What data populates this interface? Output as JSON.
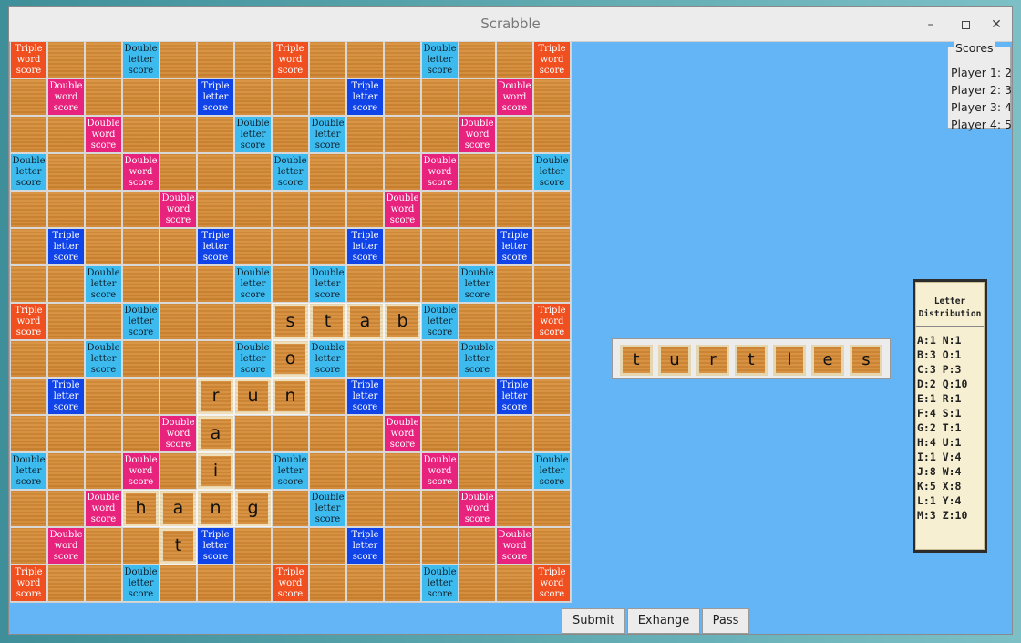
{
  "window": {
    "title": "Scrabble"
  },
  "board": {
    "rows": [
      [
        "TW",
        "",
        "",
        "DL",
        "",
        "",
        "",
        "TW",
        "",
        "",
        "",
        "DL",
        "",
        "",
        "TW"
      ],
      [
        "",
        "DW",
        "",
        "",
        "",
        "TL",
        "",
        "",
        "",
        "TL",
        "",
        "",
        "",
        "DW",
        ""
      ],
      [
        "",
        "",
        "DW",
        "",
        "",
        "",
        "DL",
        "",
        "DL",
        "",
        "",
        "",
        "DW",
        "",
        ""
      ],
      [
        "DL",
        "",
        "",
        "DW",
        "",
        "",
        "",
        "DL",
        "",
        "",
        "",
        "DW",
        "",
        "",
        "DL"
      ],
      [
        "",
        "",
        "",
        "",
        "DW",
        "",
        "",
        "",
        "",
        "",
        "DW",
        "",
        "",
        "",
        ""
      ],
      [
        "",
        "TL",
        "",
        "",
        "",
        "TL",
        "",
        "",
        "",
        "TL",
        "",
        "",
        "",
        "TL",
        ""
      ],
      [
        "",
        "",
        "DL",
        "",
        "",
        "",
        "DL",
        "",
        "DL",
        "",
        "",
        "",
        "DL",
        "",
        ""
      ],
      [
        "TW",
        "",
        "",
        "DL",
        "",
        "",
        "",
        "=s",
        "=t",
        "=a",
        "=b",
        "DL",
        "",
        "",
        "TW"
      ],
      [
        "",
        "",
        "DL",
        "",
        "",
        "",
        "DL",
        "=o",
        "DL",
        "",
        "",
        "",
        "DL",
        "",
        ""
      ],
      [
        "",
        "TL",
        "",
        "",
        "",
        "=r",
        "=u",
        "=n",
        "",
        "TL",
        "",
        "",
        "",
        "TL",
        ""
      ],
      [
        "",
        "",
        "",
        "",
        "DW",
        "=a",
        "",
        "",
        "",
        "",
        "DW",
        "",
        "",
        "",
        ""
      ],
      [
        "DL",
        "",
        "",
        "DW",
        "",
        "=i",
        "",
        "DL",
        "",
        "",
        "",
        "DW",
        "",
        "",
        "DL"
      ],
      [
        "",
        "",
        "DW",
        "=h",
        "=a",
        "=n",
        "=g",
        "",
        "DL",
        "",
        "",
        "",
        "DW",
        "",
        ""
      ],
      [
        "",
        "DW",
        "",
        "",
        "=t",
        "TL",
        "",
        "",
        "",
        "TL",
        "",
        "",
        "",
        "DW",
        ""
      ],
      [
        "TW",
        "",
        "",
        "DL",
        "",
        "",
        "",
        "TW",
        "",
        "",
        "",
        "DL",
        "",
        "",
        "TW"
      ]
    ],
    "labels": {
      "TW": "Triple word score",
      "DW": "Double word score",
      "TL": "Triple letter score",
      "DL": "Double letter score"
    }
  },
  "scores": {
    "title": "Scores",
    "players": [
      "Player 1: 2",
      "Player 2: 3",
      "Player 3: 4",
      "Player 4: 5"
    ]
  },
  "rack": {
    "tiles": [
      "t",
      "u",
      "r",
      "t",
      "l",
      "e",
      "s"
    ]
  },
  "distribution": {
    "title_line1": "Letter",
    "title_line2": "Distribution",
    "rows": [
      "A:1 N:1",
      "B:3 O:1",
      "C:3 P:3",
      "D:2 Q:10",
      "E:1 R:1",
      "F:4 S:1",
      "G:2 T:1",
      "H:4 U:1",
      "I:1 V:4",
      "J:8 W:4",
      "K:5 X:8",
      "L:1 Y:4",
      "M:3 Z:10"
    ]
  },
  "buttons": {
    "submit": "Submit",
    "exchange": "Exhange",
    "pass": "Pass"
  }
}
